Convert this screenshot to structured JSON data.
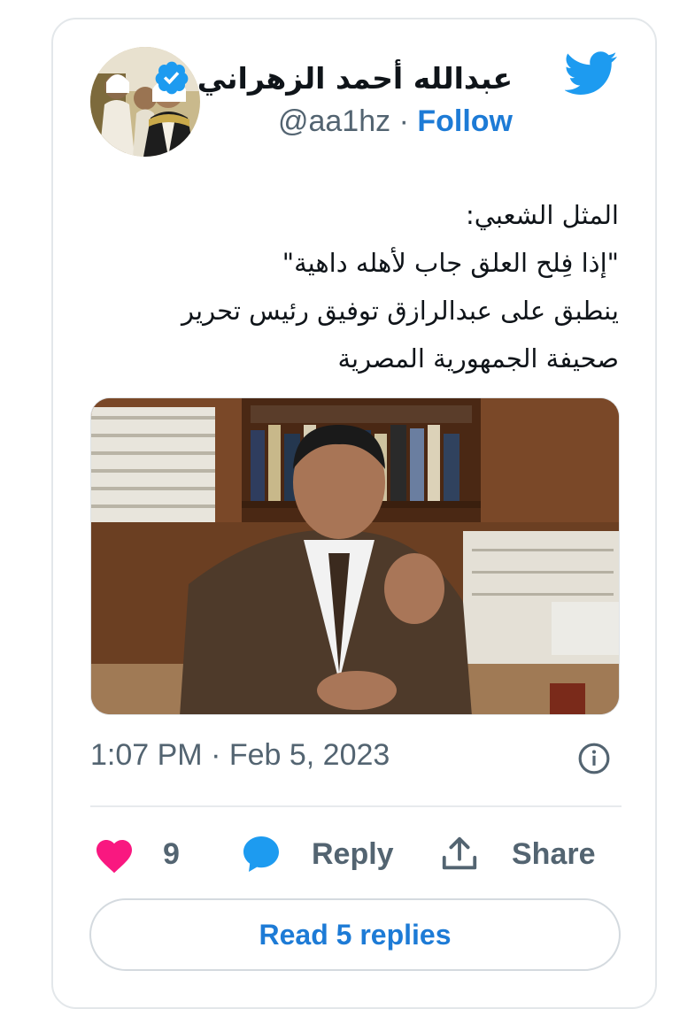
{
  "tweet": {
    "display_name": "عبدالله أحمد الزهراني",
    "handle": "@aa1hz",
    "separator": "·",
    "follow_label": "Follow",
    "text_lines": [
      "المثل الشعبي:",
      "\"إذا فِلح العلق جاب لأهله داهية\"",
      "ينطبق على عبدالرازق توفيق رئيس تحرير",
      "صحيفة الجمهورية المصرية"
    ],
    "timestamp": "1:07 PM · Feb 5, 2023",
    "likes_count": "9",
    "reply_label": "Reply",
    "share_label": "Share",
    "read_replies_label": "Read 5 replies"
  },
  "colors": {
    "twitter_blue": "#1d9bf0",
    "link_blue": "#1d7bd6",
    "like_pink": "#f91880",
    "muted_text": "#536471",
    "primary_text": "#0f1419"
  },
  "icons": {
    "logo": "twitter-bird-icon",
    "verified": "verified-badge-icon",
    "info": "info-icon",
    "like": "heart-icon",
    "reply": "speech-bubble-icon",
    "share": "share-upload-icon"
  }
}
